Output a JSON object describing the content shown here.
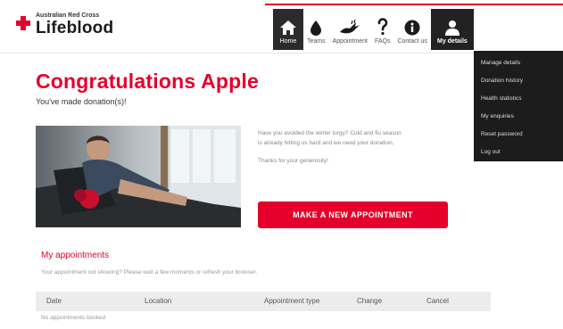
{
  "brand": {
    "small": "Australian Red Cross",
    "big": "Lifeblood"
  },
  "nav": {
    "items": [
      {
        "label": "Home",
        "icon": "home-icon"
      },
      {
        "label": "Teams",
        "icon": "drop-icon"
      },
      {
        "label": "Appointment",
        "icon": "dove-icon"
      },
      {
        "label": "FAQs",
        "icon": "question-icon"
      },
      {
        "label": "Contact us",
        "icon": "info-icon"
      },
      {
        "label": "My details",
        "icon": "user-icon"
      }
    ]
  },
  "dropdown": {
    "items": [
      "Manage details",
      "Donation history",
      "Health statistics",
      "My enquiries",
      "Reset password",
      "Log out"
    ]
  },
  "hero": {
    "title": "Congratulations Apple",
    "subtitle": "You've made donation(s)!"
  },
  "message": {
    "line1": "Have you avoided the winter lurgy? Cold and flu season",
    "line2": "is already hitting us hard and we need your donation.",
    "thanks": "Thanks for your generosity!"
  },
  "cta": {
    "label": "MAKE A NEW APPOINTMENT"
  },
  "appointments": {
    "title": "My appointments",
    "note": "Your appointment not showing? Please wait a few moments or refresh your browser.",
    "columns": [
      "Date",
      "Location",
      "Appointment type",
      "Change",
      "Cancel"
    ],
    "empty": "No appointments booked"
  },
  "colors": {
    "accent": "#e4002b",
    "dark": "#222222"
  }
}
